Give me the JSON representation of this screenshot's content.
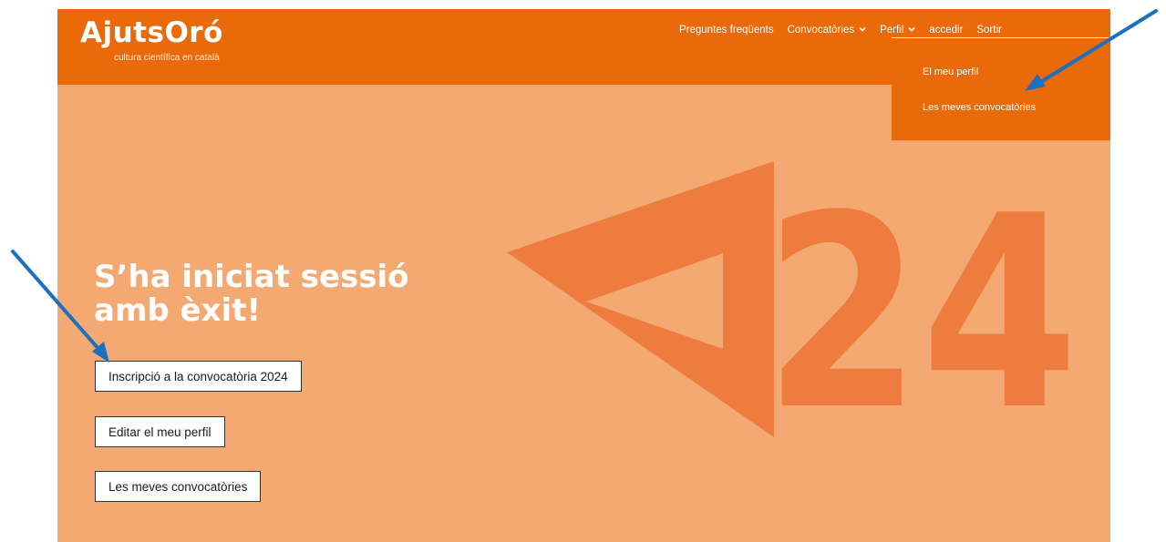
{
  "brand": {
    "title": "AjutsOró",
    "tagline": "cultura científica en català",
    "accent_color": "#ea6a0a",
    "hero_color": "#f3a971",
    "deco_color": "#ee7c3e"
  },
  "nav": {
    "items": [
      {
        "label": "Preguntes freqüents",
        "has_dropdown": false
      },
      {
        "label": "Convocatòries",
        "has_dropdown": true,
        "icon": "chevron-down-icon"
      },
      {
        "label": "Perfil",
        "has_dropdown": true,
        "icon": "chevron-down-icon"
      },
      {
        "label": "accedir",
        "has_dropdown": false
      },
      {
        "label": "Sortir",
        "has_dropdown": false
      }
    ]
  },
  "profile_menu": {
    "items": [
      "El meu perfil",
      "Les meves convocatòries"
    ]
  },
  "hero": {
    "heading_line1": "S’ha iniciat sessió",
    "heading_line2": "amb èxit!",
    "deco_text": "24",
    "buttons": [
      "Inscripció a la convocatòria 2024",
      "Editar el meu perfil",
      "Les meves convocatòries"
    ]
  },
  "annotations": {
    "arrow_color": "#1f6fbf",
    "arrows": [
      "arrow-to-les-meves-convocatories",
      "arrow-to-inscripcio-button"
    ]
  }
}
